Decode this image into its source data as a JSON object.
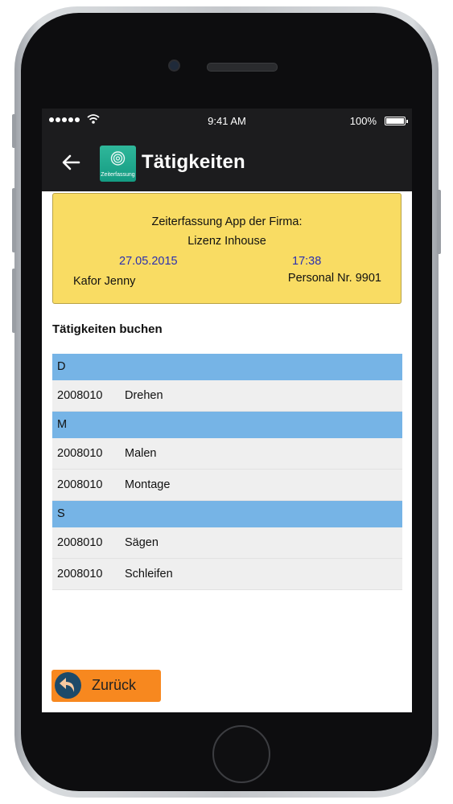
{
  "status_bar": {
    "time": "9:41 AM",
    "battery_percent": "100%"
  },
  "app_bar": {
    "title": "Tätigkeiten",
    "logo_text": "Zeiterfassung",
    "back_icon": "arrow-left-icon"
  },
  "info_card": {
    "line1": "Zeiterfassung App der Firma:",
    "line2": "Lizenz Inhouse",
    "date": "27.05.2015",
    "time": "17:38",
    "name": "Kafor Jenny",
    "personal_nr": "Personal Nr. 9901"
  },
  "section_title": "Tätigkeiten buchen",
  "groups": [
    {
      "letter": "D",
      "items": [
        {
          "code": "2008010",
          "name": "Drehen"
        }
      ]
    },
    {
      "letter": "M",
      "items": [
        {
          "code": "2008010",
          "name": "Malen"
        },
        {
          "code": "2008010",
          "name": "Montage"
        }
      ]
    },
    {
      "letter": "S",
      "items": [
        {
          "code": "2008010",
          "name": "Sägen"
        },
        {
          "code": "2008010",
          "name": "Schleifen"
        }
      ]
    }
  ],
  "back_button": {
    "label": "Zurück",
    "icon": "undo-icon"
  },
  "colors": {
    "card_yellow": "#f9dc63",
    "group_header_blue": "#76b4e6",
    "back_button_orange": "#f7881f",
    "date_time_blue": "#2a2fb0"
  }
}
